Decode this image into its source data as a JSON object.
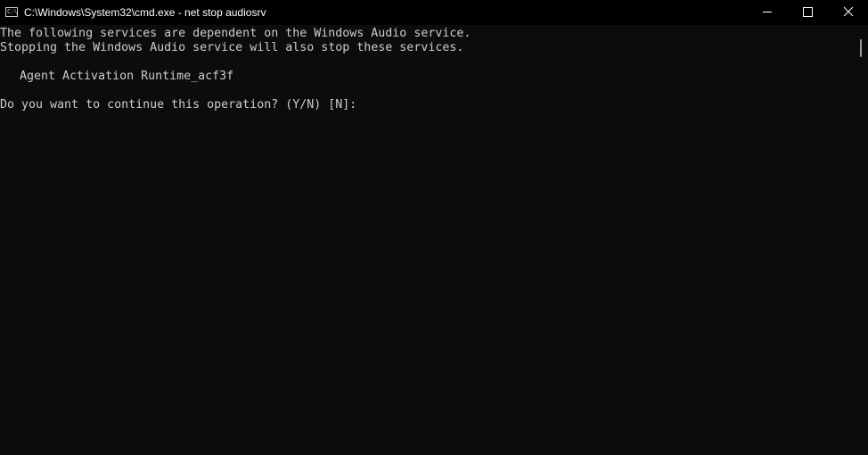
{
  "window": {
    "title": "C:\\Windows\\System32\\cmd.exe - net  stop audiosrv",
    "app_icon_glyph": "C:\\",
    "controls": {
      "minimize_icon": "minimize-icon",
      "maximize_icon": "maximize-icon",
      "close_icon": "close-icon"
    }
  },
  "console": {
    "lines": [
      "The following services are dependent on the Windows Audio service.",
      "Stopping the Windows Audio service will also stop these services.",
      "Agent Activation Runtime_acf3f",
      "Do you want to continue this operation? (Y/N) [N]:"
    ]
  },
  "colors": {
    "background": "#0c0c0c",
    "titlebar": "#000000",
    "text": "#cccccc"
  }
}
